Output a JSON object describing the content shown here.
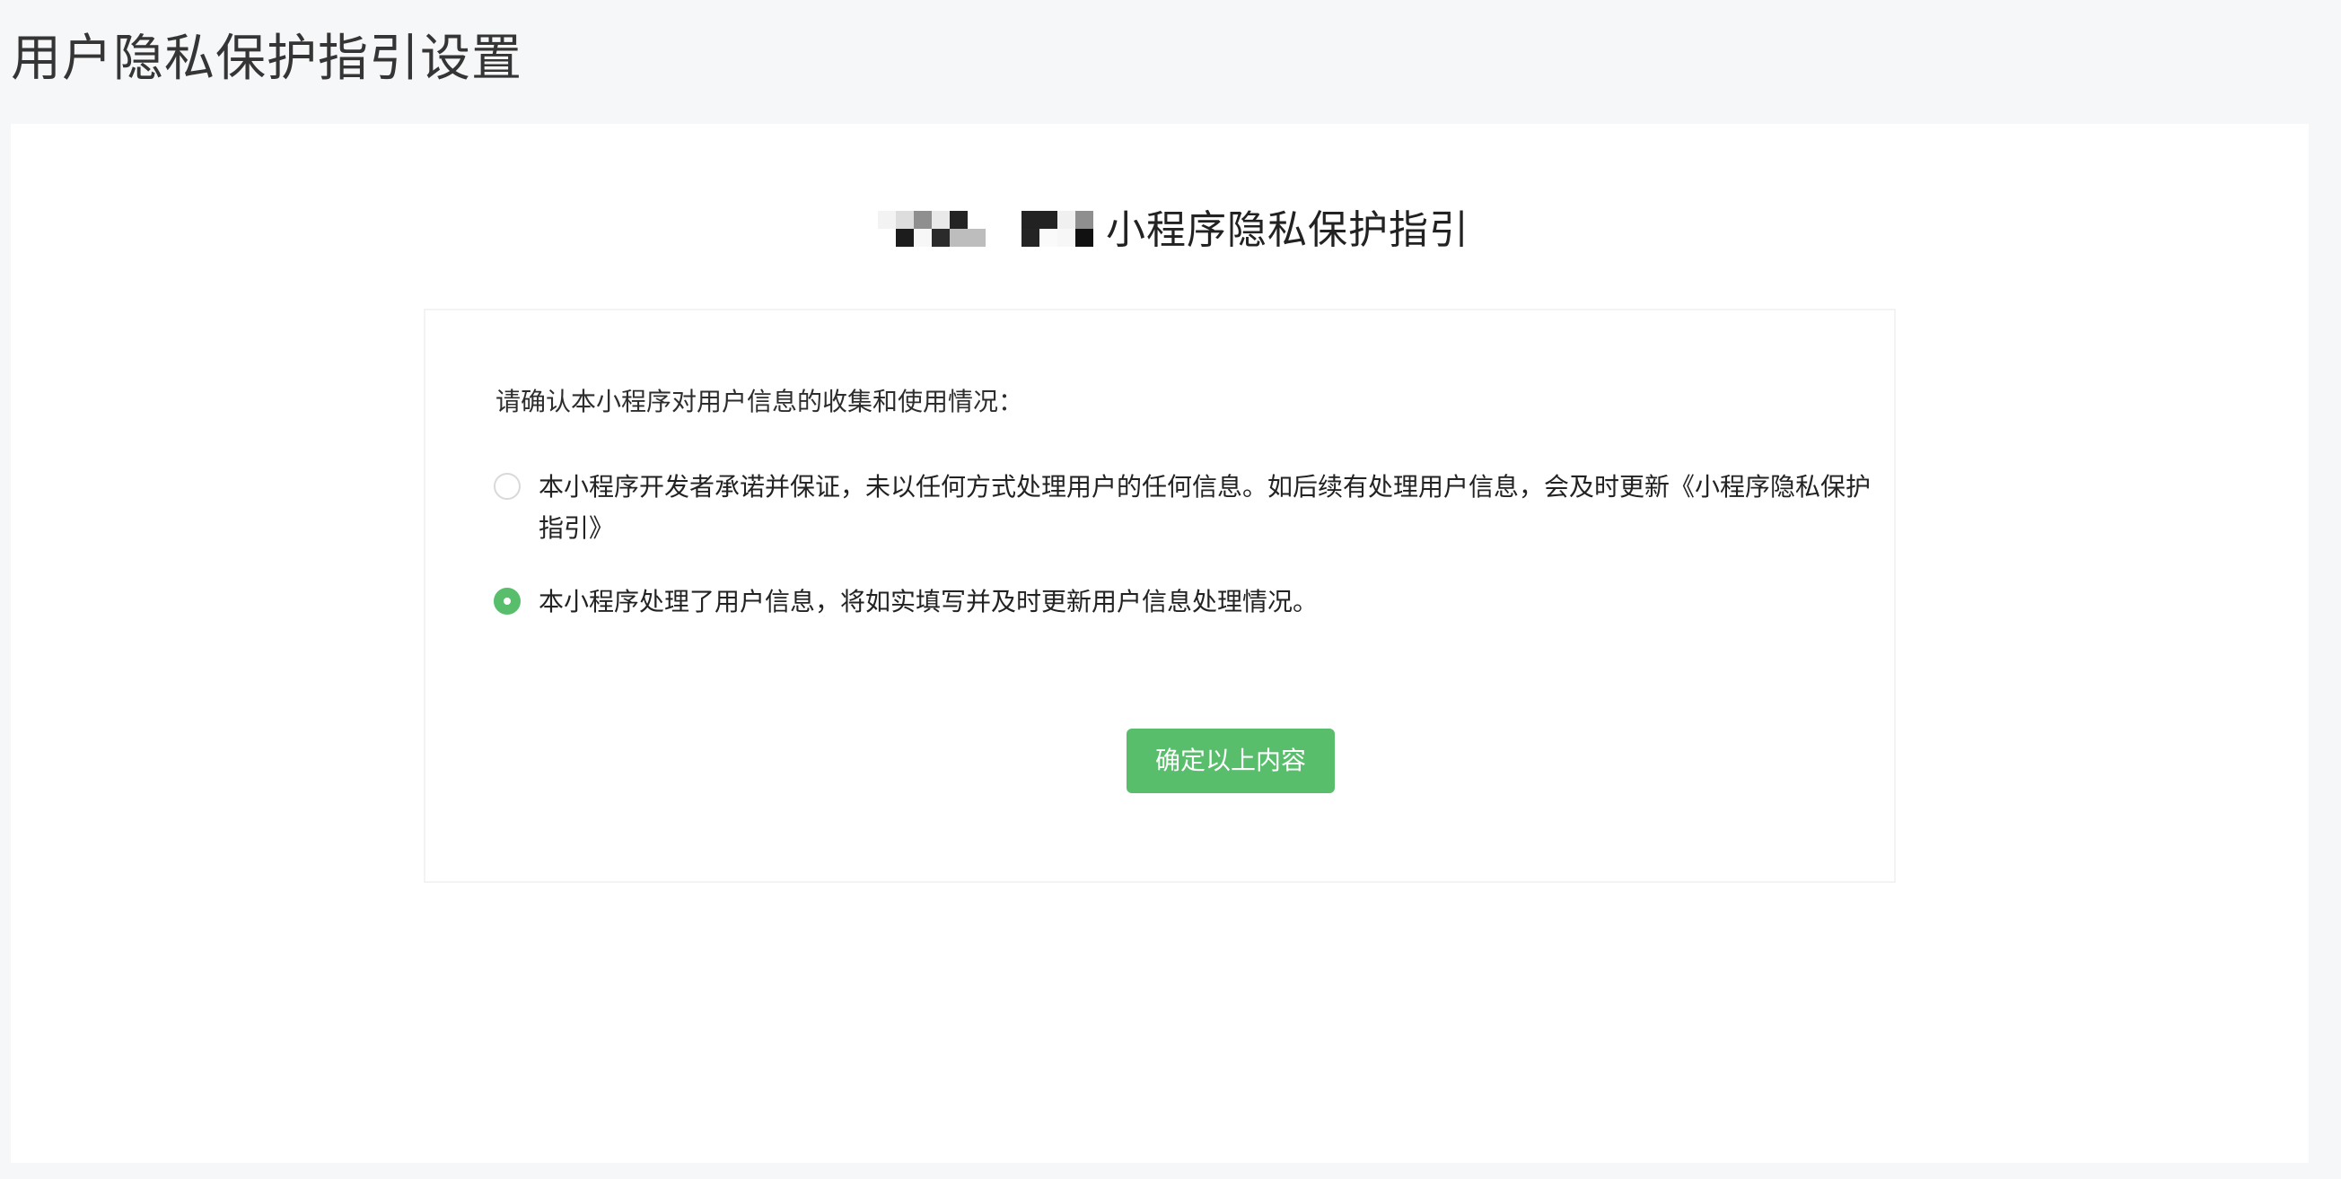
{
  "header": {
    "title": "用户隐私保护指引设置"
  },
  "guide": {
    "title_suffix": "小程序隐私保护指引",
    "name_redacted": true
  },
  "form": {
    "question": "请确认本小程序对用户信息的收集和使用情况：",
    "options": [
      {
        "label": "本小程序开发者承诺并保证，未以任何方式处理用户的任何信息。如后续有处理用户信息，会及时更新《小程序隐私保护指引》",
        "selected": false
      },
      {
        "label": "本小程序处理了用户信息，将如实填写并及时更新用户信息处理情况。",
        "selected": true
      }
    ],
    "confirm_label": "确定以上内容"
  },
  "colors": {
    "accent": "#58be6c",
    "background": "#f6f7f9",
    "card": "#ffffff"
  }
}
